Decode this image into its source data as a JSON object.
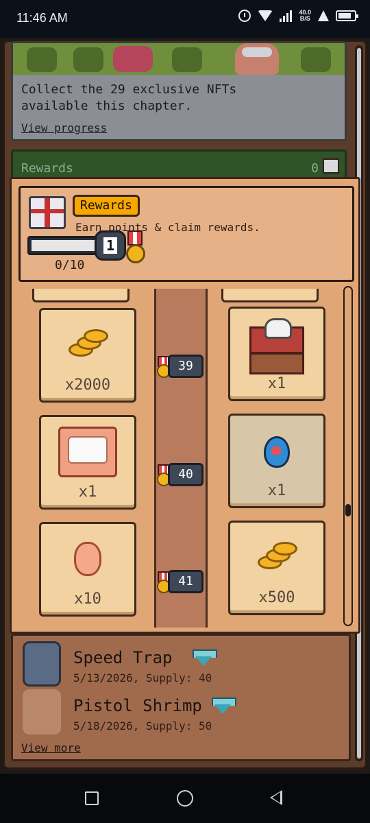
{
  "status_bar": {
    "time": "11:46 AM",
    "net_speed_value": "40.0",
    "net_speed_unit": "B/S",
    "icons": [
      "alarm-icon",
      "wifi-icon",
      "signal-icon",
      "flask-icon",
      "battery-icon"
    ]
  },
  "nft_banner": {
    "line1": "Collect the 29 exclusive NFTs",
    "line2": "available this chapter.",
    "link": "View progress"
  },
  "rewards_bar": {
    "label": "Rewards",
    "count": "0"
  },
  "rewards_panel": {
    "title_badge": "Rewards",
    "subtitle": "Earn points & claim rewards.",
    "level": "1",
    "progress_text": "0/10",
    "progress": {
      "current": 0,
      "max": 10
    },
    "levels": [
      {
        "level": "39",
        "left": {
          "item": "coins",
          "icon": "coins-icon",
          "qty": "x2000"
        },
        "right": {
          "item": "chef-chest",
          "icon": "chest-icon",
          "qty": "x1"
        }
      },
      {
        "level": "40",
        "left": {
          "item": "bed",
          "icon": "bed-icon",
          "qty": "x1"
        },
        "right": {
          "item": "egg",
          "icon": "egg-icon",
          "qty": "x1"
        }
      },
      {
        "level": "41",
        "left": {
          "item": "gem",
          "icon": "gem-icon",
          "qty": "x10"
        },
        "right": {
          "item": "coins",
          "icon": "coins-icon",
          "qty": "x500"
        }
      }
    ]
  },
  "nft_list": {
    "items": [
      {
        "name": "Speed Trap",
        "meta": "5/13/2026, Supply: 40",
        "icon": "diamond-icon"
      },
      {
        "name": "Pistol Shrimp",
        "meta": "5/18/2026, Supply: 50",
        "icon": "diamond-icon"
      }
    ],
    "view_more": "View more"
  },
  "colors": {
    "panel": "#e1a676",
    "tile": "#f1d2a0",
    "badge": "#f6a800",
    "rewards_bar": "#2e5428",
    "frame": "#5b3b2a"
  }
}
